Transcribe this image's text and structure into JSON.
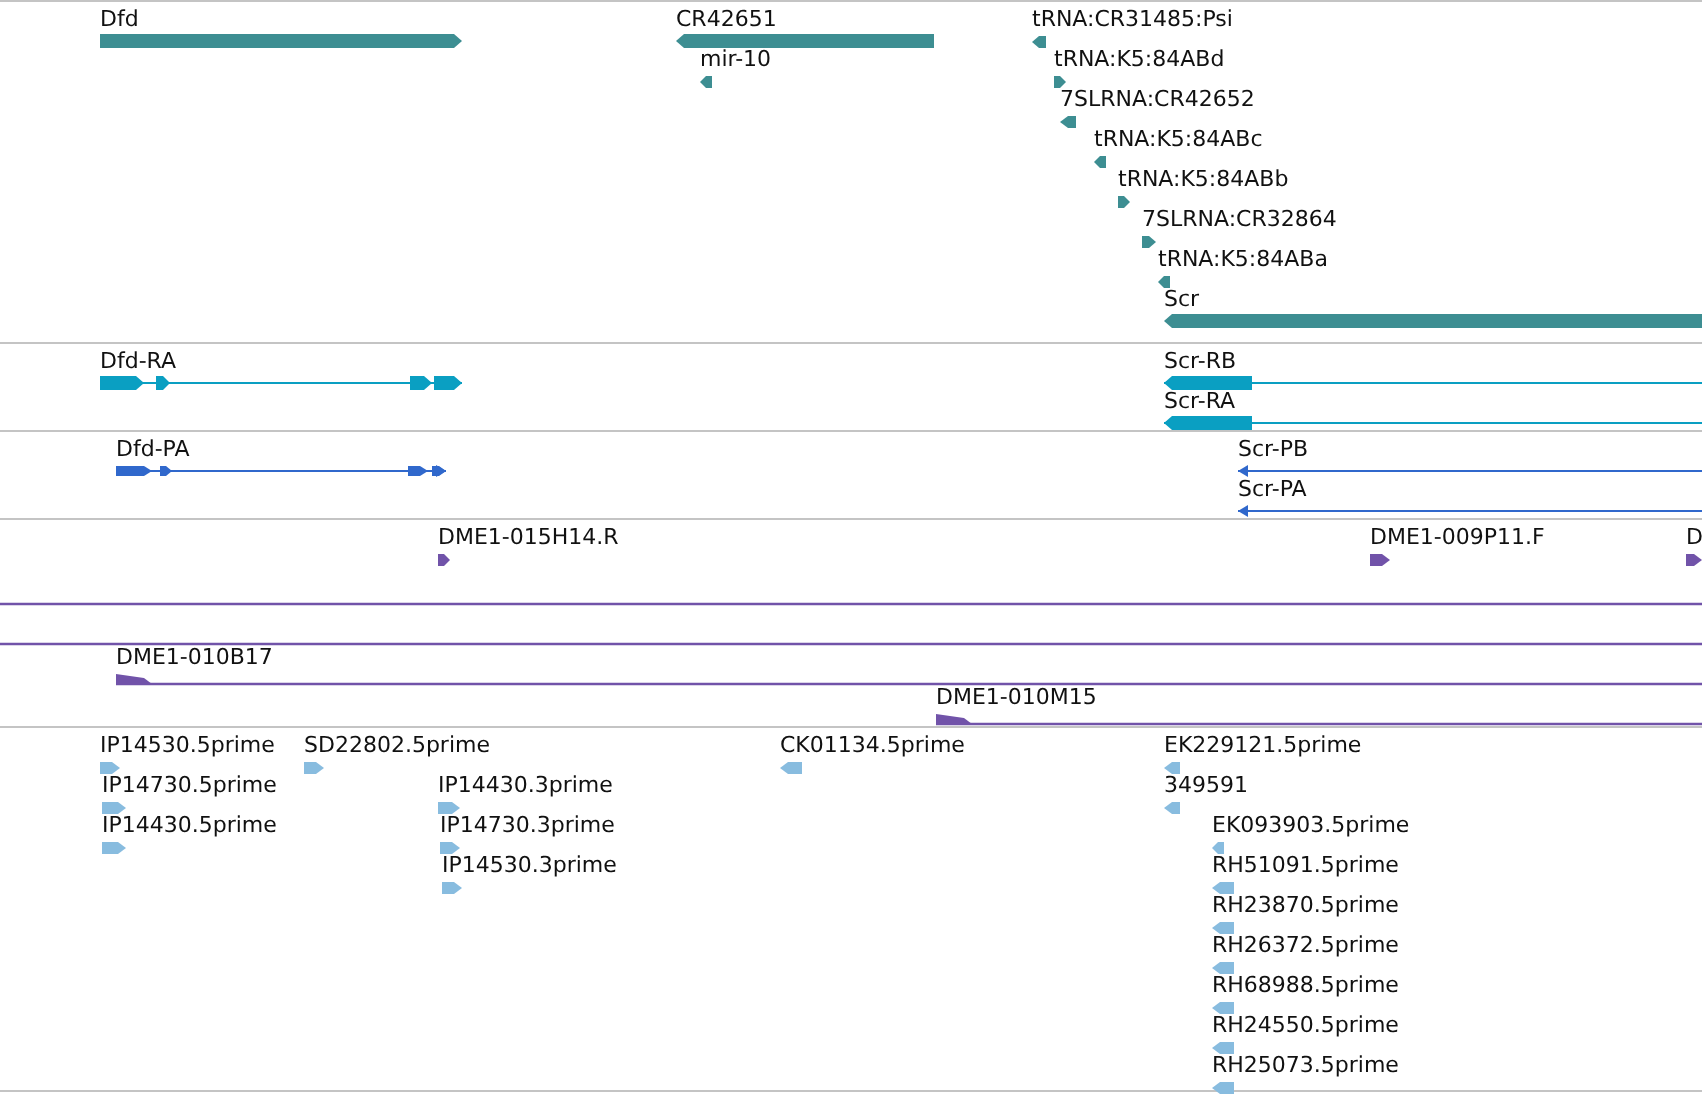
{
  "tracks": [
    {
      "color": "#3d8e92",
      "features": [
        {
          "kind": "gene",
          "label": "Dfd",
          "forward": true
        },
        {
          "kind": "gene",
          "label": "CR42651",
          "forward": false
        },
        {
          "kind": "point",
          "label": "mir-10",
          "forward": false
        },
        {
          "kind": "point",
          "label": "tRNA:CR31485:Psi",
          "forward": false
        },
        {
          "kind": "point",
          "label": "tRNA:K5:84ABd",
          "forward": true
        },
        {
          "kind": "point",
          "label": "7SLRNA:CR42652",
          "forward": false
        },
        {
          "kind": "point",
          "label": "tRNA:K5:84ABc",
          "forward": false
        },
        {
          "kind": "point",
          "label": "tRNA:K5:84ABb",
          "forward": true
        },
        {
          "kind": "point",
          "label": "7SLRNA:CR32864",
          "forward": true
        },
        {
          "kind": "point",
          "label": "tRNA:K5:84ABa",
          "forward": false
        },
        {
          "kind": "gene",
          "label": "Scr",
          "forward": false
        }
      ]
    },
    {
      "color": "#0a9fc2",
      "features": [
        {
          "kind": "transcript",
          "label": "Dfd-RA",
          "forward": true
        },
        {
          "kind": "transcript",
          "label": "Scr-RB",
          "forward": false
        },
        {
          "kind": "transcript",
          "label": "Scr-RA",
          "forward": false
        }
      ]
    },
    {
      "color": "#3068cc",
      "features": [
        {
          "kind": "transcript",
          "label": "Dfd-PA",
          "forward": true
        },
        {
          "kind": "transcript",
          "label": "Scr-PB",
          "forward": false
        },
        {
          "kind": "transcript",
          "label": "Scr-PA",
          "forward": false
        }
      ]
    },
    {
      "color": "#7153a9",
      "features": [
        {
          "kind": "point",
          "label": "DME1-015H14.R",
          "forward": true
        },
        {
          "kind": "point",
          "label": "DME1-009P11.F",
          "forward": true
        },
        {
          "kind": "point",
          "label": "D",
          "forward": true
        },
        {
          "kind": "span"
        },
        {
          "kind": "span"
        },
        {
          "kind": "span",
          "label": "DME1-010B17",
          "forward": true
        },
        {
          "kind": "span",
          "label": "DME1-010M15",
          "forward": true
        }
      ]
    },
    {
      "color": "#88bcdf",
      "features": [
        {
          "kind": "point",
          "label": "IP14530.5prime",
          "forward": true
        },
        {
          "kind": "point",
          "label": "SD22802.5prime",
          "forward": true
        },
        {
          "kind": "point",
          "label": "IP14730.5prime",
          "forward": true
        },
        {
          "kind": "point",
          "label": "IP14430.5prime",
          "forward": true
        },
        {
          "kind": "point",
          "label": "IP14430.3prime",
          "forward": true
        },
        {
          "kind": "point",
          "label": "IP14730.3prime",
          "forward": true
        },
        {
          "kind": "point",
          "label": "IP14530.3prime",
          "forward": true
        },
        {
          "kind": "point",
          "label": "CK01134.5prime",
          "forward": false
        },
        {
          "kind": "point",
          "label": "EK229121.5prime",
          "forward": false
        },
        {
          "kind": "point",
          "label": "349591",
          "forward": false
        },
        {
          "kind": "point",
          "label": "EK093903.5prime",
          "forward": false
        },
        {
          "kind": "point",
          "label": "RH51091.5prime",
          "forward": false
        },
        {
          "kind": "point",
          "label": "RH23870.5prime",
          "forward": false
        },
        {
          "kind": "point",
          "label": "RH26372.5prime",
          "forward": false
        },
        {
          "kind": "point",
          "label": "RH68988.5prime",
          "forward": false
        },
        {
          "kind": "point",
          "label": "RH24550.5prime",
          "forward": false
        },
        {
          "kind": "point",
          "label": "RH25073.5prime",
          "forward": false
        }
      ]
    }
  ]
}
